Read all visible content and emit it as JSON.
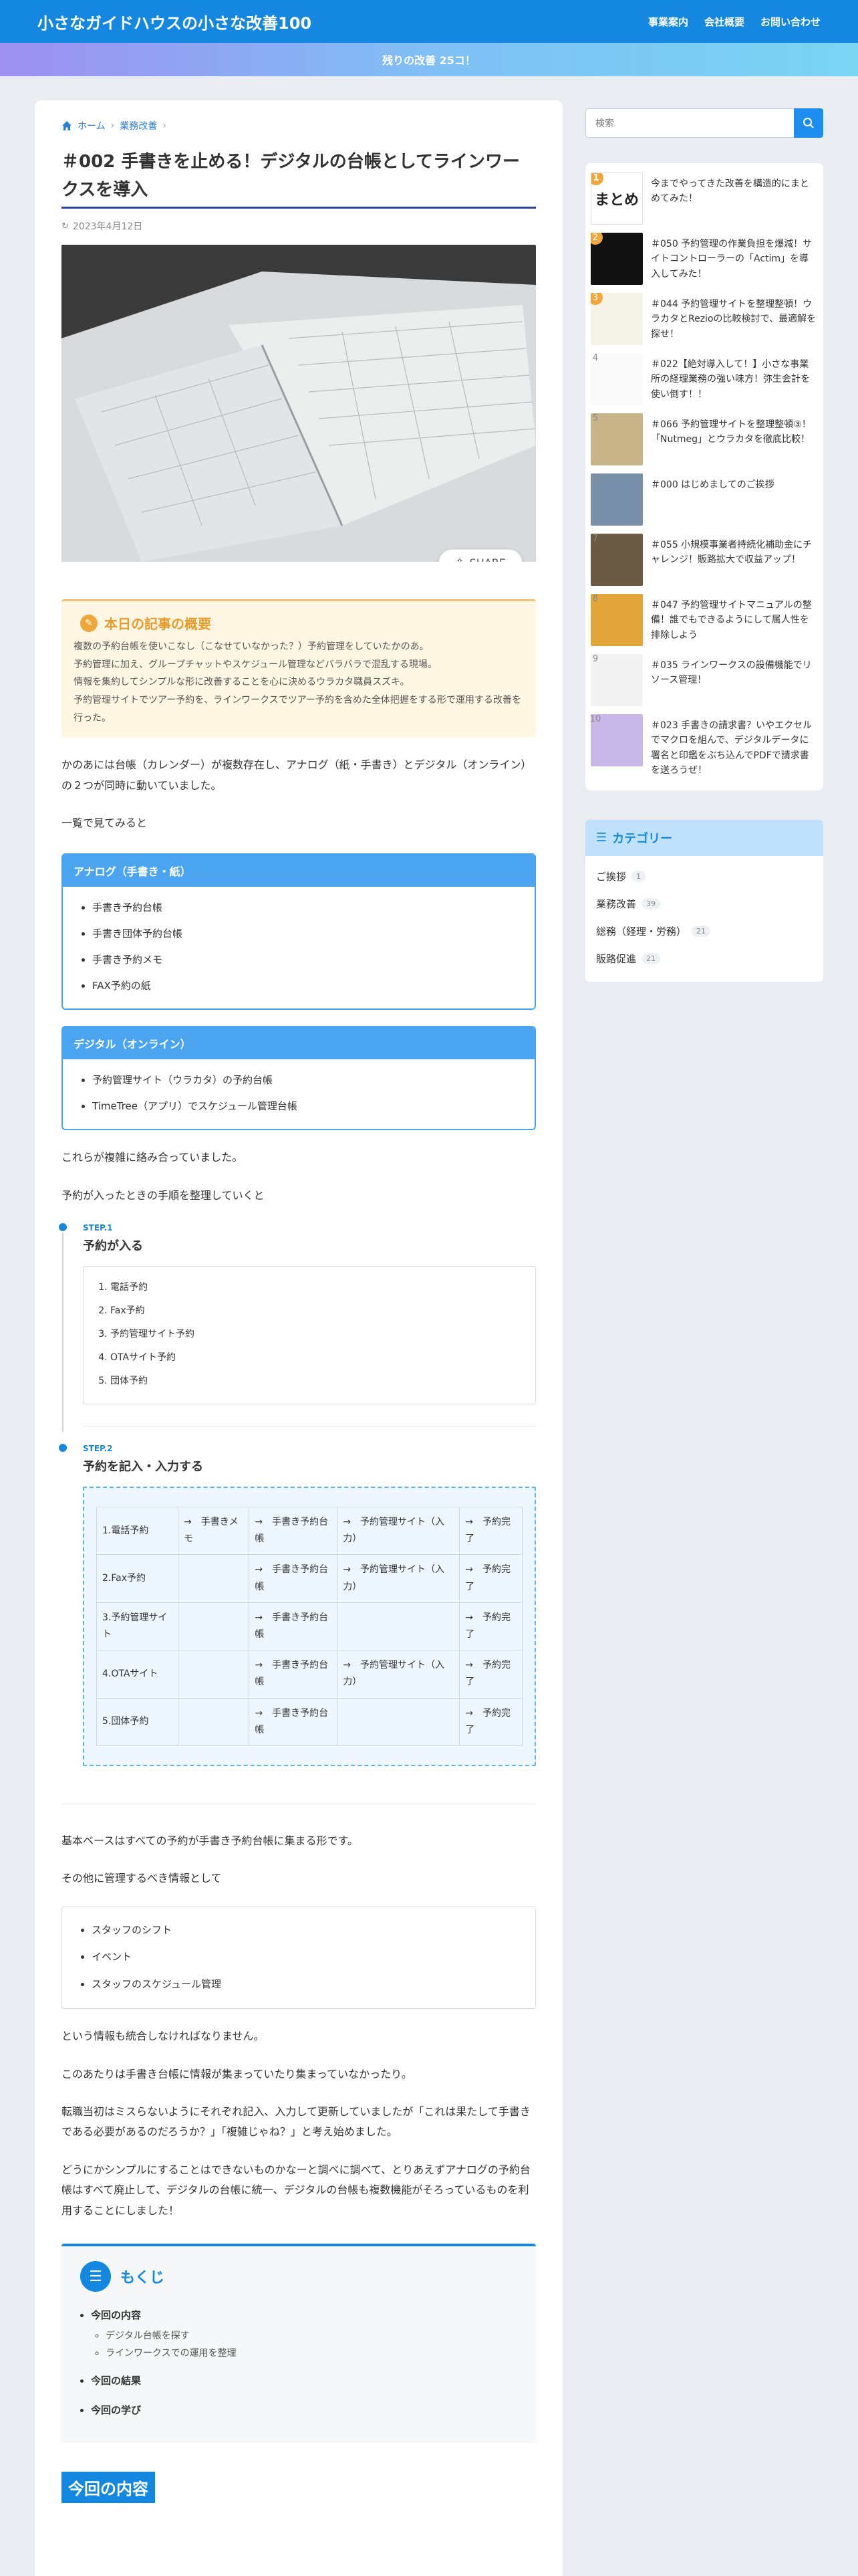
{
  "header": {
    "site_title": "小さなガイドハウスの小さな改善100",
    "nav": [
      "事業案内",
      "会社概要",
      "お問い合わせ"
    ]
  },
  "notice": "残りの改善 25コ！",
  "breadcrumb": {
    "home": "ホーム",
    "category": "業務改善"
  },
  "article": {
    "title": "＃002 手書きを止める！デジタルの台帳としてラインワークスを導入",
    "date": "2023年4月12日",
    "share": "SHARE",
    "summary_title": "本日の記事の概要",
    "summary_lines": [
      "複数の予約台帳を使いこなし（こなせていなかった？）予約管理をしていたかのあ。",
      "予約管理に加え、グループチャットやスケジュール管理などバラバラで混乱する現場。",
      "情報を集約してシンプルな形に改善することを心に決めるウラカタ職員スズキ。",
      "予約管理サイトでツアー予約を、ラインワークスでツアー予約を含めた全体把握をする形で運用する改善を行った。"
    ],
    "para1": "かのあには台帳（カレンダー）が複数存在し、アナログ（紙・手書き）とデジタル（オンライン）の２つが同時に動いていました。",
    "para2": "一覧で見てみると",
    "analog": {
      "head": "アナログ（手書き・紙）",
      "items": [
        "手書き予約台帳",
        "手書き団体予約台帳",
        "手書き予約メモ",
        "FAX予約の紙"
      ]
    },
    "digital": {
      "head": "デジタル（オンライン）",
      "items": [
        "予約管理サイト（ウラカタ）の予約台帳",
        "TimeTree（アプリ）でスケジュール管理台帳"
      ]
    },
    "para3": "これらが複雑に絡み合っていました。",
    "para4": "予約が入ったときの手順を整理していくと",
    "step1": {
      "label": "STEP.1",
      "title": "予約が入る",
      "items": [
        "電話予約",
        "Fax予約",
        "予約管理サイト予約",
        "OTAサイト予約",
        "団体予約"
      ]
    },
    "step2": {
      "label": "STEP.2",
      "title": "予約を記入・入力する",
      "rows": [
        [
          "1.電話予約",
          "→　手書きメモ",
          "→　手書き予約台帳",
          "→　予約管理サイト（入力）",
          "→　予約完了"
        ],
        [
          "2.Fax予約",
          "",
          "→　手書き予約台帳",
          "→　予約管理サイト（入力）",
          "→　予約完了"
        ],
        [
          "3.予約管理サイト",
          "",
          "→　手書き予約台帳",
          "",
          "→　予約完了"
        ],
        [
          "4.OTAサイト",
          "",
          "→　手書き予約台帳",
          "→　予約管理サイト（入力）",
          "→　予約完了"
        ],
        [
          "5.団体予約",
          "",
          "→　手書き予約台帳",
          "",
          "→　予約完了"
        ]
      ]
    },
    "para5": "基本ベースはすべての予約が手書き予約台帳に集まる形です。",
    "para6": "その他に管理するべき情報として",
    "other_items": [
      "スタッフのシフト",
      "イベント",
      "スタッフのスケジュール管理"
    ],
    "para7": "という情報も統合しなければなりません。",
    "para8": "このあたりは手書き台帳に情報が集まっていたり集まっていなかったり。",
    "para9": "転職当初はミスらないようにそれぞれ記入、入力して更新していましたが「これは果たして手書きである必要があるのだろうか？」「複雑じゃね？」と考え始めました。",
    "para10": "どうにかシンプルにすることはできないものかなーと調べに調べて、とりあえずアナログの予約台帳はすべて廃止して、デジタルの台帳に統一、デジタルの台帳も複数機能がそろっているものを利用することにしました！",
    "toc": {
      "title": "もくじ",
      "items": [
        {
          "label": "今回の内容",
          "children": [
            "デジタル台帳を探す",
            "ラインワークスでの運用を整理"
          ]
        },
        {
          "label": "今回の結果",
          "children": []
        },
        {
          "label": "今回の学び",
          "children": []
        }
      ]
    },
    "section_heading": "今回の内容"
  },
  "sidebar": {
    "search_placeholder": "検索",
    "ranking": [
      {
        "num": "1",
        "title": "今までやってきた改善を構造的にまとめてみた！",
        "thumb": "まとめ"
      },
      {
        "num": "2",
        "title": "＃050 予約管理の作業負担を爆減！サイトコントローラーの「Actim」を導入してみた！",
        "thumb": ""
      },
      {
        "num": "3",
        "title": "＃044 予約管理サイトを整理整頓！ウラカタとRezioの比較検討で、最適解を探せ！",
        "thumb": ""
      },
      {
        "num": "4",
        "title": "＃022【絶対導入して！】小さな事業所の経理業務の強い味方！弥生会計を使い倒す！！",
        "thumb": ""
      },
      {
        "num": "5",
        "title": "＃066 予約管理サイトを整理整頓③！「Nutmeg」とウラカタを徹底比較！",
        "thumb": ""
      },
      {
        "num": "6",
        "title": "＃000 はじめましてのご挨拶",
        "thumb": ""
      },
      {
        "num": "7",
        "title": "＃055 小規模事業者持続化補助金にチャレンジ！販路拡大で収益アップ！",
        "thumb": ""
      },
      {
        "num": "8",
        "title": "＃047 予約管理サイトマニュアルの整備！誰でもできるようにして属人性を排除しよう",
        "thumb": ""
      },
      {
        "num": "9",
        "title": "＃035 ラインワークスの設備機能でリソース管理！",
        "thumb": ""
      },
      {
        "num": "10",
        "title": "＃023 手書きの請求書？いやエクセルでマクロを組んで、デジタルデータに署名と印鑑をぶち込んでPDFで請求書を送ろうぜ！",
        "thumb": ""
      }
    ],
    "category_title": "カテゴリー",
    "categories": [
      {
        "name": "ご挨拶",
        "count": "1"
      },
      {
        "name": "業務改善",
        "count": "39"
      },
      {
        "name": "総務（経理・労務）",
        "count": "21"
      },
      {
        "name": "販路促進",
        "count": "21"
      }
    ]
  },
  "colors": {
    "primary": "#1488e0",
    "accent": "#f0a73a"
  }
}
